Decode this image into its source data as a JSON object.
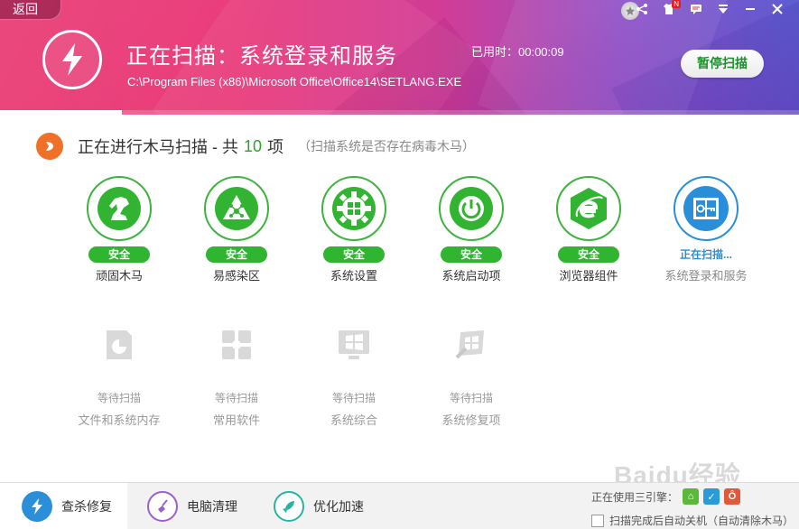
{
  "header": {
    "back_label": "返回",
    "scan_title": "正在扫描：系统登录和服务",
    "scan_path": "C:\\Program Files (x86)\\Microsoft Office\\Office14\\SETLANG.EXE",
    "elapsed": "已用时：00:00:09",
    "pause_label": "暂停扫描",
    "progress": 0.153,
    "notify_badge": "N"
  },
  "section": {
    "title": "正在进行木马扫描 - 共",
    "count": "10",
    "unit": "项",
    "note": "（扫描系统是否存在病毒木马）"
  },
  "scanned_items": [
    {
      "name": "顽固木马",
      "status": "安全",
      "icon": "horse-icon"
    },
    {
      "name": "易感染区",
      "status": "安全",
      "icon": "warning-network-icon"
    },
    {
      "name": "系统设置",
      "status": "安全",
      "icon": "windows-gear-icon"
    },
    {
      "name": "系统启动项",
      "status": "安全",
      "icon": "power-icon"
    },
    {
      "name": "浏览器组件",
      "status": "安全",
      "icon": "ie-browser-icon"
    },
    {
      "name": "系统登录和服务",
      "status": "正在扫描...",
      "icon": "login-service-icon"
    }
  ],
  "pending_items": [
    {
      "name": "文件和系统内存",
      "status": "等待扫描",
      "icon": "memory-icon"
    },
    {
      "name": "常用软件",
      "status": "等待扫描",
      "icon": "software-icon"
    },
    {
      "name": "系统综合",
      "status": "等待扫描",
      "icon": "system-windows-icon"
    },
    {
      "name": "系统修复项",
      "status": "等待扫描",
      "icon": "repair-icon"
    }
  ],
  "bottom": {
    "tabs": [
      {
        "label": "查杀修复",
        "icon": "lightning-icon"
      },
      {
        "label": "电脑清理",
        "icon": "broom-icon"
      },
      {
        "label": "优化加速",
        "icon": "rocket-icon"
      }
    ],
    "engines_label": "正在使用三引擎：",
    "shutdown_label": "扫描完成后自动关机（自动清除木马）"
  },
  "watermark": "Baidu经验",
  "colors": {
    "safe_green": "#2fb52f",
    "scanning_blue": "#2a8fd8",
    "section_orange": "#f07028"
  }
}
